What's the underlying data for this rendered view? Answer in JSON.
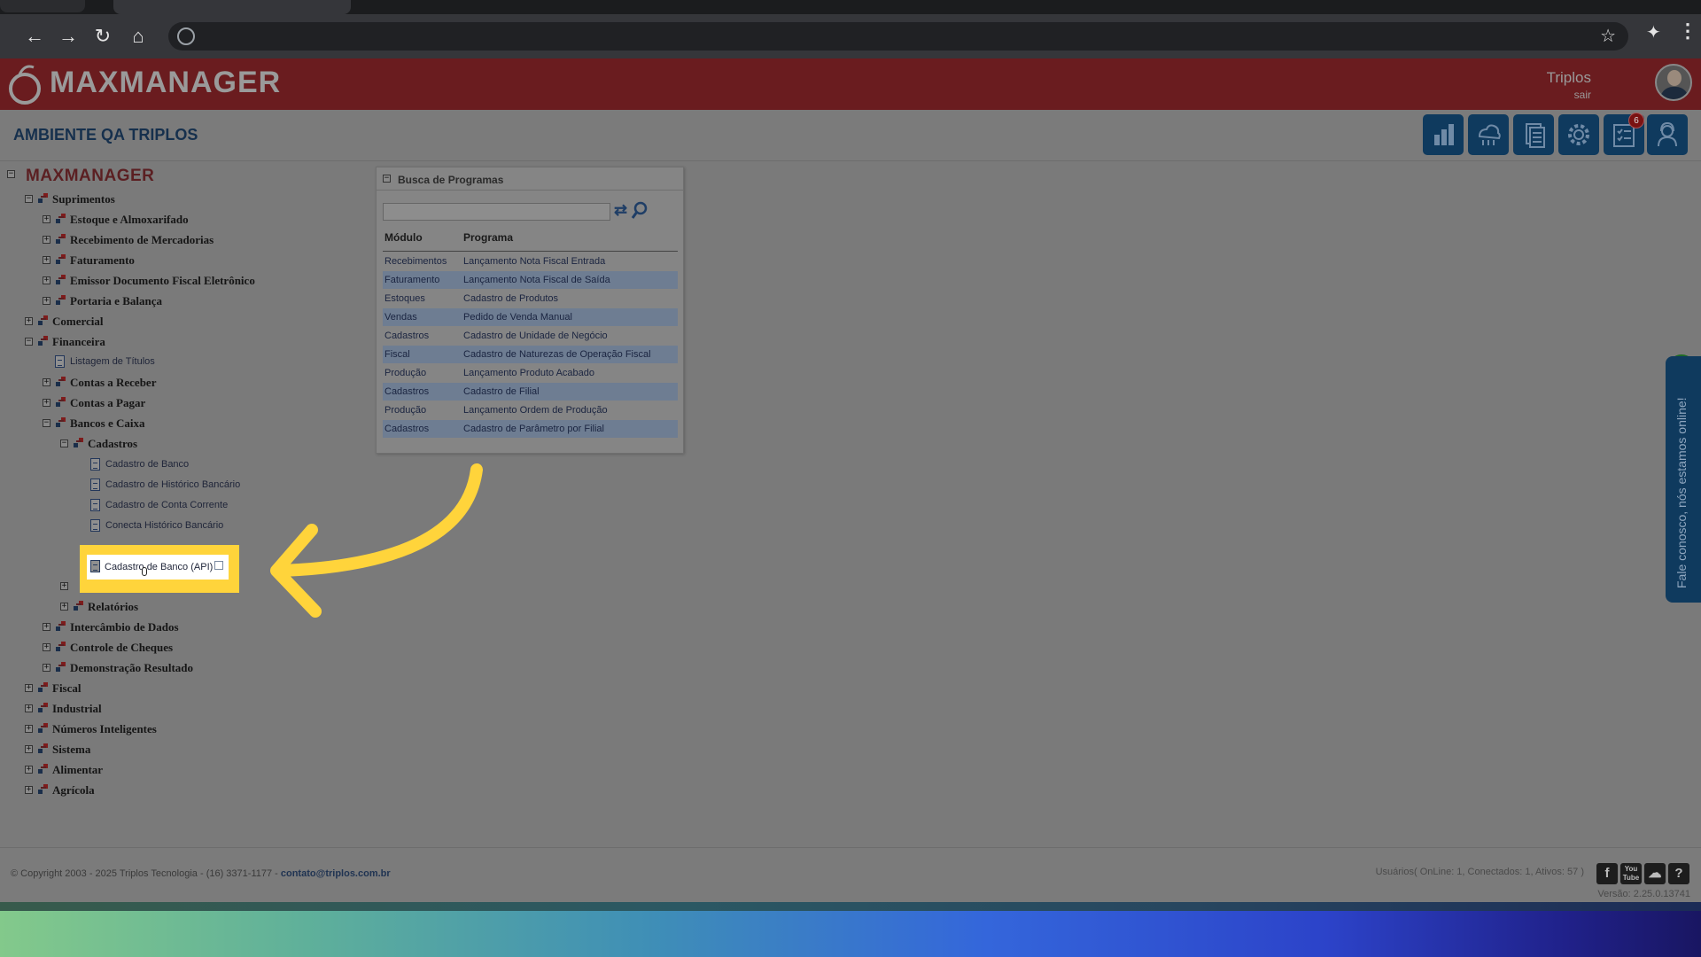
{
  "app": {
    "brand": "MAXMANAGER",
    "user_name": "Triplos",
    "logout_label": "sair",
    "environment_title": "AMBIENTE QA TRIPLOS",
    "notification_count": "6"
  },
  "quick_actions": [
    {
      "icon": "reports-chart-icon"
    },
    {
      "icon": "api-cloud-icon"
    },
    {
      "icon": "documents-icon"
    },
    {
      "icon": "settings-gear-icon"
    },
    {
      "icon": "tasks-checklist-icon"
    },
    {
      "icon": "support-agent-icon"
    }
  ],
  "tree": {
    "root": "MAXMANAGER",
    "items": [
      "Suprimentos",
      "Estoque e Almoxarifado",
      "Recebimento de Mercadorias",
      "Faturamento",
      "Emissor Documento Fiscal Eletrônico",
      "Portaria e Balança",
      "Comercial",
      "Financeira",
      "Listagem de Títulos",
      "Contas a Receber",
      "Contas a Pagar",
      "Bancos e Caixa",
      "Cadastros",
      "Cadastro de Banco",
      "Cadastro de Histórico Bancário",
      "Cadastro de Conta Corrente",
      "Conecta Histórico Bancário",
      "Cadastro de Banco (API)",
      "Relatórios",
      "Intercâmbio de Dados",
      "Controle de Cheques",
      "Demonstração Resultado",
      "Fiscal",
      "Industrial",
      "Números Inteligentes",
      "Sistema",
      "Alimentar",
      "Agrícola"
    ]
  },
  "busca": {
    "title": "Busca de Programas",
    "search_value": "",
    "col_modulo": "Módulo",
    "col_programa": "Programa",
    "rows": [
      {
        "modulo": "Recebimentos",
        "programa": "Lançamento Nota Fiscal Entrada"
      },
      {
        "modulo": "Faturamento",
        "programa": "Lançamento Nota Fiscal de Saída"
      },
      {
        "modulo": "Estoques",
        "programa": "Cadastro de Produtos"
      },
      {
        "modulo": "Vendas",
        "programa": "Pedido de Venda Manual"
      },
      {
        "modulo": "Cadastros",
        "programa": "Cadastro de Unidade de Negócio"
      },
      {
        "modulo": "Fiscal",
        "programa": "Cadastro de Naturezas de Operação Fiscal"
      },
      {
        "modulo": "Produção",
        "programa": "Lançamento Produto Acabado"
      },
      {
        "modulo": "Cadastros",
        "programa": "Cadastro de Filial"
      },
      {
        "modulo": "Produção",
        "programa": "Lançamento Ordem de Produção"
      },
      {
        "modulo": "Cadastros",
        "programa": "Cadastro de Parâmetro por Filial"
      }
    ]
  },
  "chat": {
    "label": "Fale conosco, nós estamos online!"
  },
  "footer": {
    "copyright": "© Copyright 2003 - 2025 Triplos Tecnologia - (16) 3371-1177 - ",
    "email": "contato@triplos.com.br",
    "users": "Usuários( OnLine: 1, Conectados: 1, Ativos: 57 )",
    "version": "Versão:  2.25.0.13741",
    "social": [
      "f",
      "You Tube",
      "cloud",
      "?"
    ]
  },
  "colors": {
    "header_red": "#6a1c1f",
    "brand_blue": "#0f3a5e",
    "highlight_yellow": "#ffd43b",
    "chat_online_green": "#1d6b24"
  }
}
